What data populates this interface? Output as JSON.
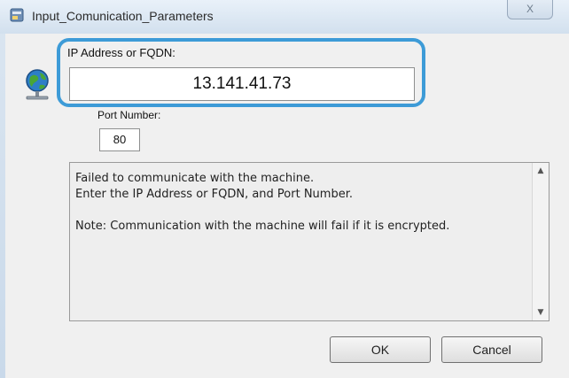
{
  "window": {
    "title": "Input_Comunication_Parameters",
    "close_label": "X"
  },
  "form": {
    "ip_label": "IP Address or FQDN:",
    "ip_value": "13.141.41.73",
    "port_label": "Port Number:",
    "port_value": "80"
  },
  "message": {
    "text": "Failed to communicate with the machine.\nEnter the IP Address or FQDN, and Port Number.\n\nNote: Communication with the machine will fail if it is encrypted."
  },
  "buttons": {
    "ok_label": "OK",
    "cancel_label": "Cancel"
  },
  "icons": {
    "app": "application-icon",
    "network": "network-globe-icon",
    "scroll_up": "scroll-up-arrow-icon",
    "scroll_down": "scroll-down-arrow-icon"
  },
  "colors": {
    "highlight": "#3d9bd7"
  }
}
